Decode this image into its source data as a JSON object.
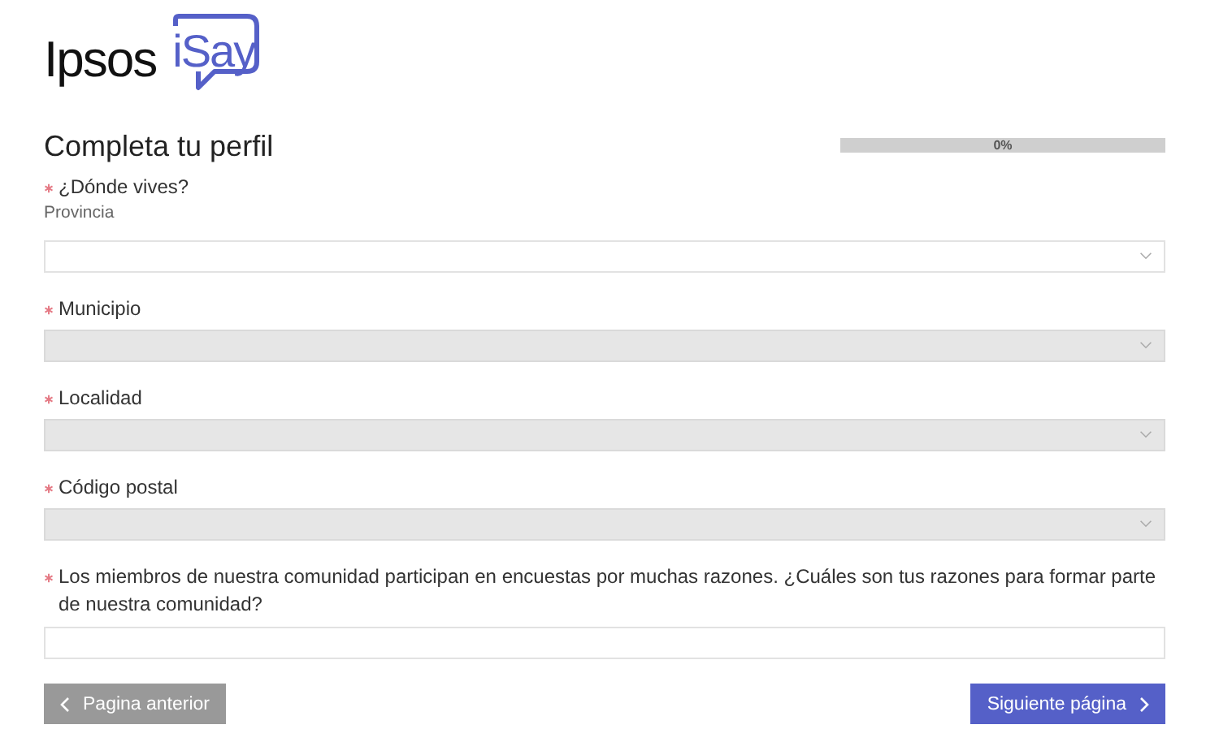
{
  "logo": {
    "brand": "Ipsos",
    "product": "iSay"
  },
  "title": "Completa tu perfil",
  "progress": {
    "level": 0,
    "label": "0%"
  },
  "questions": [
    {
      "kind": "dropdown",
      "label": "¿Dónde vives?",
      "sublabel": "Provincia",
      "required": true,
      "disabled": false
    },
    {
      "kind": "dropdown",
      "label": "Municipio",
      "required": true,
      "disabled": true
    },
    {
      "kind": "dropdown",
      "label": "Localidad",
      "required": true,
      "disabled": true
    },
    {
      "kind": "dropdown",
      "label": "Código postal",
      "required": true,
      "disabled": true
    },
    {
      "kind": "text",
      "label": "Los miembros de nuestra comunidad participan en encuestas por muchas razones. ¿Cuáles son tus razones para formar parte de nuestra comunidad?",
      "required": true,
      "disabled": false
    }
  ],
  "buttons": {
    "previous": "Pagina anterior",
    "next": "Siguiente página"
  }
}
